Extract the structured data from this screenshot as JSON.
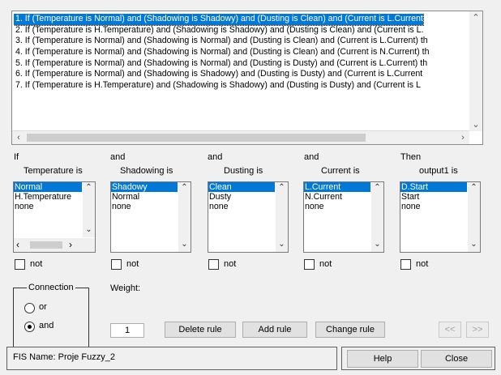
{
  "rules": [
    "1. If (Temperature is Normal) and (Shadowing is Shadowy) and (Dusting is Clean) and (Current is L.Current",
    "2. If (Temperature is H.Temperature) and (Shadowing is Shadowy) and (Dusting is Clean) and (Current is L.",
    "3. If (Temperature is Normal) and (Shadowing is Normal) and (Dusting is Clean) and (Current is L.Current) th",
    "4. If (Temperature is Normal) and (Shadowing is Normal) and (Dusting is Clean) and (Current is N.Current) th",
    "5. If (Temperature is Normal) and (Shadowing is Normal) and (Dusting is Dusty) and (Current is L.Current) th",
    "6. If (Temperature is Normal) and (Shadowing is Shadowy) and (Dusting is Dusty) and (Current is L.Current",
    "7. If (Temperature is H.Temperature) and (Shadowing is Shadowy) and (Dusting is Dusty) and (Current is L"
  ],
  "columns": [
    {
      "connector": "If",
      "label": "Temperature is",
      "items": [
        "Normal",
        "H.Temperature",
        "none"
      ],
      "not_label": "not"
    },
    {
      "connector": "and",
      "label": "Shadowing is",
      "items": [
        "Shadowy",
        "Normal",
        "none"
      ],
      "not_label": "not"
    },
    {
      "connector": "and",
      "label": "Dusting is",
      "items": [
        "Clean",
        "Dusty",
        "none"
      ],
      "not_label": "not"
    },
    {
      "connector": "and",
      "label": "Current is",
      "items": [
        "L.Current",
        "N.Current",
        "none"
      ],
      "not_label": "not"
    },
    {
      "connector": "Then",
      "label": "output1 is",
      "items": [
        "D.Start",
        "Start",
        "none"
      ],
      "not_label": "not"
    }
  ],
  "connection": {
    "title": "Connection",
    "or_label": "or",
    "and_label": "and",
    "selected": "and"
  },
  "weight": {
    "label": "Weight:",
    "value": "1"
  },
  "buttons": {
    "delete": "Delete rule",
    "add": "Add rule",
    "change": "Change rule",
    "prev": "<<",
    "next": ">>",
    "help": "Help",
    "close": "Close"
  },
  "status": {
    "fis_name": "FIS Name: Proje Fuzzy_2"
  },
  "icons": {
    "up": "up-arrow-icon",
    "down": "down-arrow-icon",
    "left": "left-arrow-icon",
    "right": "right-arrow-icon"
  },
  "colors": {
    "selection": "#0078d7",
    "background": "#f0f0f0"
  }
}
